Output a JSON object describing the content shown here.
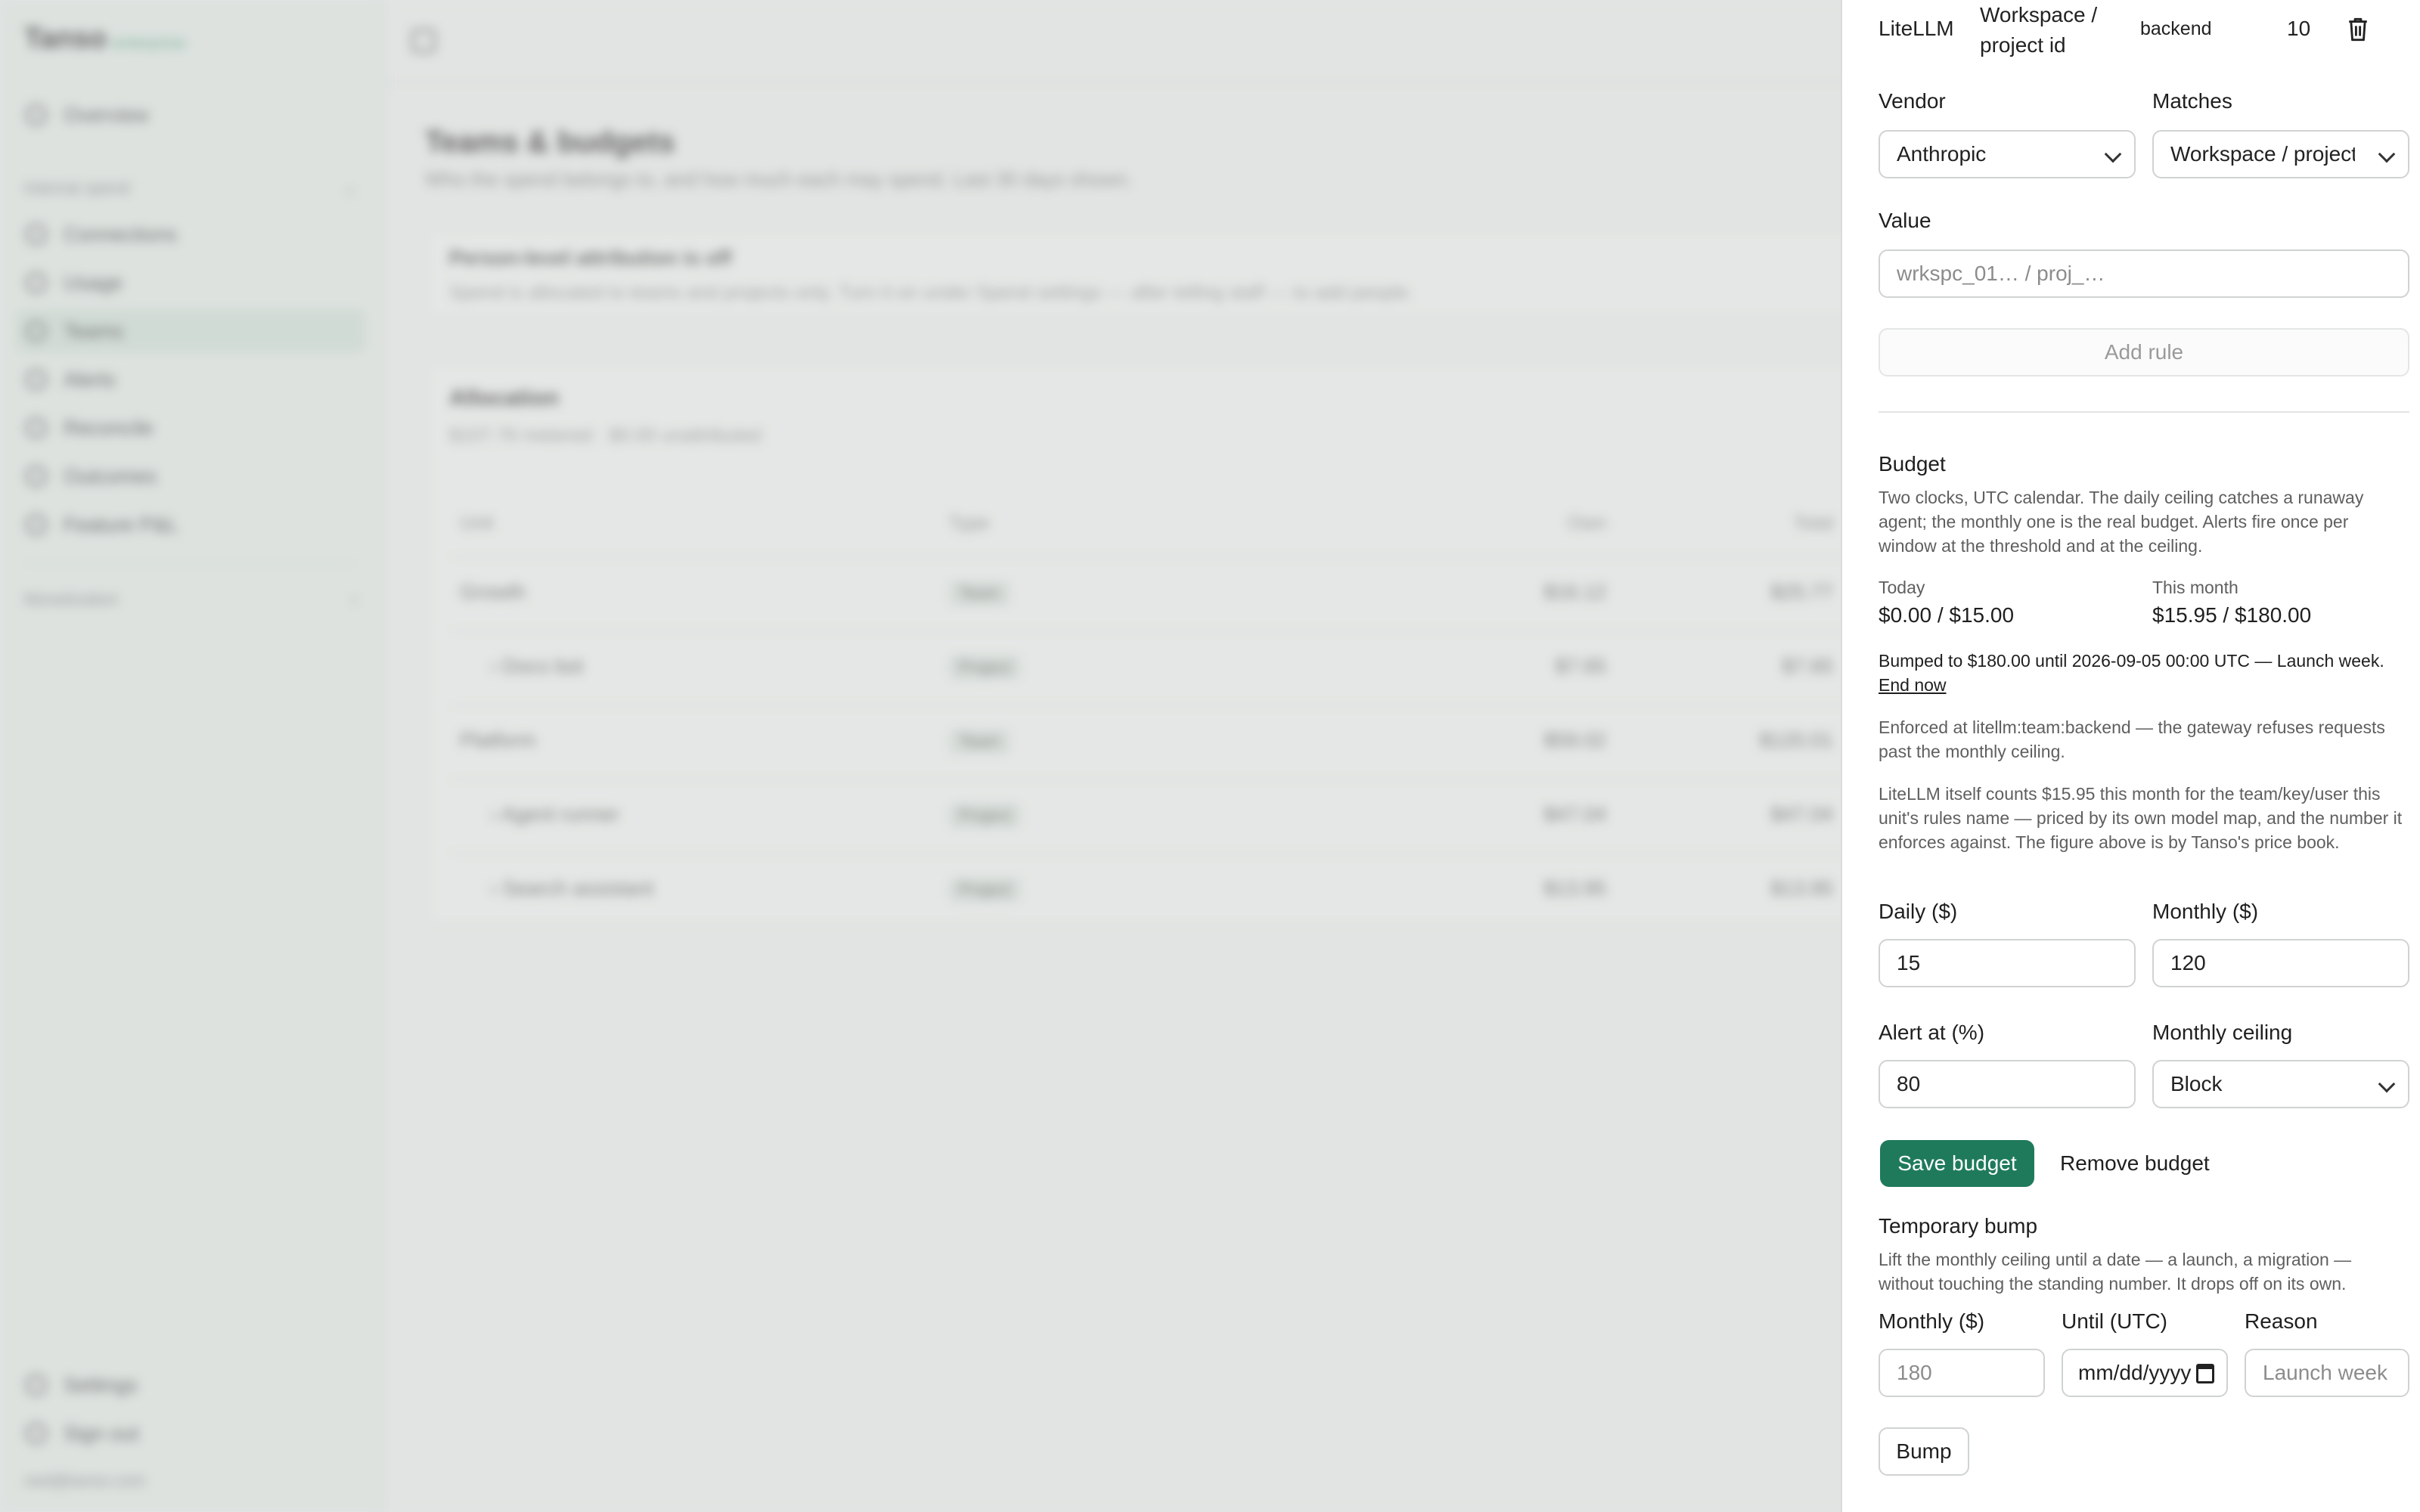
{
  "background": {
    "brand": "Tanso",
    "brand_tag": "enterprise",
    "nav": {
      "overview": "Overview",
      "section_internal": "Internal spend",
      "items": [
        "Connections",
        "Usage",
        "Teams",
        "Alerts",
        "Reconcile",
        "Outcomes",
        "Feature P&L"
      ],
      "section_monetization": "Monetization",
      "settings": "Settings",
      "sign_out": "Sign out",
      "user_email": "ned@tanso.com"
    },
    "page_title": "Teams & budgets",
    "page_subtitle": "Who the spend belongs to, and how much each may spend. Last 30 days shown.",
    "notice_title": "Person-level attribution is off",
    "notice_body": "Spend is allocated to teams and projects only. Turn it on under Spend settings — after telling staff — to add people.",
    "allocation": {
      "title": "Allocation",
      "subtitle": "$107.76 metered · $0.00 unattributed",
      "headers": [
        "Unit",
        "Type",
        "Own",
        "Total"
      ],
      "rows": [
        {
          "unit": "Growth",
          "type": "Team",
          "own": "$16.12",
          "total": "$25.77"
        },
        {
          "unit": "› Docs bot",
          "type": "Project",
          "own": "$7.65",
          "total": "$7.65"
        },
        {
          "unit": "Platform",
          "type": "Team",
          "own": "$59.02",
          "total": "$120.01"
        },
        {
          "unit": "› Agent runner",
          "type": "Project",
          "own": "$47.04",
          "total": "$47.04"
        },
        {
          "unit": "› Search assistant",
          "type": "Project",
          "own": "$13.95",
          "total": "$13.95"
        }
      ]
    }
  },
  "drawer": {
    "rule": {
      "provider": "LiteLLM",
      "match": "Workspace / project id",
      "value": "backend",
      "priority": "10"
    },
    "vendor_label": "Vendor",
    "vendor_value": "Anthropic",
    "matches_label": "Matches",
    "matches_value": "Workspace / project id",
    "value_label": "Value",
    "value_placeholder": "wrkspc_01… / proj_…",
    "add_rule": "Add rule",
    "budget": {
      "title": "Budget",
      "description": "Two clocks, UTC calendar. The daily ceiling catches a runaway agent; the monthly one is the real budget. Alerts fire once per window at the threshold and at the ceiling.",
      "today_label": "Today",
      "today_value": "$0.00 / $15.00",
      "month_label": "This month",
      "month_value": "$15.95 / $180.00",
      "bump_notice": "Bumped to $180.00 until 2026-09-05 00:00 UTC — Launch week.",
      "end_now": "End now",
      "enforced": "Enforced at litellm:team:backend — the gateway refuses requests past the monthly ceiling.",
      "litellm_note": "LiteLLM itself counts $15.95 this month for the team/key/user this unit's rules name — priced by its own model map, and the number it enforces against. The figure above is by Tanso's price book.",
      "daily_label": "Daily ($)",
      "daily_value": "15",
      "monthly_label": "Monthly ($)",
      "monthly_value": "120",
      "alert_label": "Alert at (%)",
      "alert_value": "80",
      "ceiling_label": "Monthly ceiling",
      "ceiling_value": "Block",
      "save": "Save budget",
      "remove": "Remove budget"
    },
    "bump": {
      "title": "Temporary bump",
      "description": "Lift the monthly ceiling until a date — a launch, a migration — without touching the standing number. It drops off on its own.",
      "monthly_label": "Monthly ($)",
      "monthly_placeholder": "180",
      "until_label": "Until (UTC)",
      "until_placeholder": "mm/dd/yyyy",
      "reason_label": "Reason",
      "reason_placeholder": "Launch week",
      "button": "Bump"
    }
  }
}
